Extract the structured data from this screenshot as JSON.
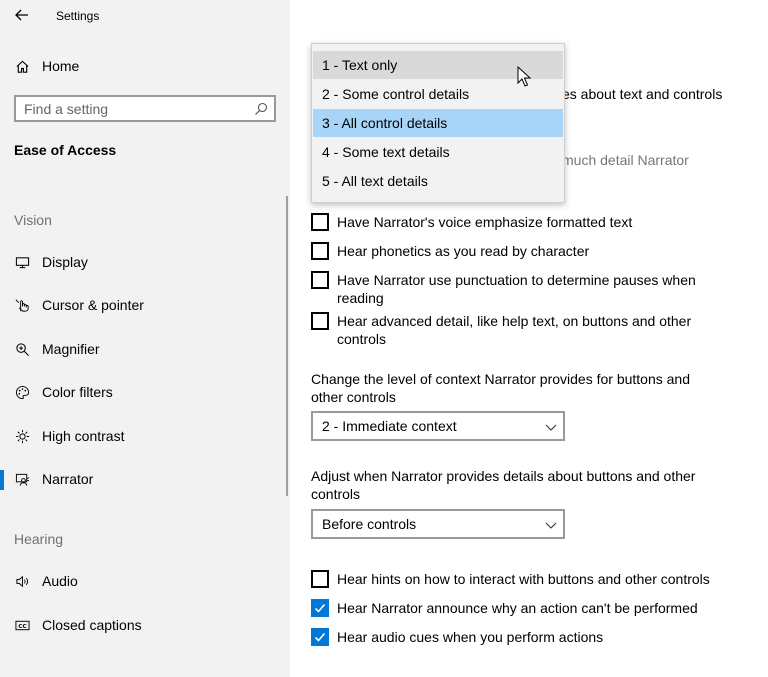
{
  "app": {
    "title": "Settings"
  },
  "sidebar": {
    "home": "Home",
    "search_placeholder": "Find a setting",
    "group_title": "Ease of Access",
    "sections": {
      "vision": "Vision",
      "hearing": "Hearing"
    },
    "items": [
      {
        "label": "Display",
        "icon": "display-icon"
      },
      {
        "label": "Cursor & pointer",
        "icon": "pointer-icon"
      },
      {
        "label": "Magnifier",
        "icon": "magnifier-icon"
      },
      {
        "label": "Color filters",
        "icon": "palette-icon"
      },
      {
        "label": "High contrast",
        "icon": "sun-icon"
      },
      {
        "label": "Narrator",
        "icon": "narrator-icon",
        "selected": true
      },
      {
        "label": "Audio",
        "icon": "speaker-icon"
      },
      {
        "label": "Closed captions",
        "icon": "captions-icon"
      }
    ]
  },
  "main": {
    "partial_text_1": "es about text and controls",
    "partial_text_2": "much detail Narrator",
    "dropdown_options": [
      {
        "label": "1 - Text only",
        "state": "hover"
      },
      {
        "label": "2 - Some control details",
        "state": "normal"
      },
      {
        "label": "3 - All control details",
        "state": "selected"
      },
      {
        "label": "4 - Some text details",
        "state": "normal"
      },
      {
        "label": "5 - All text details",
        "state": "normal"
      }
    ],
    "checkboxes_top": [
      {
        "label": "Have Narrator's voice emphasize formatted text",
        "checked": false
      },
      {
        "label": "Hear phonetics as you read by character",
        "checked": false
      },
      {
        "label": "Have Narrator use punctuation to determine pauses when reading",
        "checked": false
      },
      {
        "label": "Hear advanced detail, like help text, on buttons and other controls",
        "checked": false
      }
    ],
    "context_level": {
      "label": "Change the level of context Narrator provides for buttons and other controls",
      "value": "2 - Immediate context"
    },
    "details_timing": {
      "label": "Adjust when Narrator provides details about buttons and other controls",
      "value": "Before controls"
    },
    "checkboxes_bottom": [
      {
        "label": "Hear hints on how to interact with buttons and other controls",
        "checked": false
      },
      {
        "label": "Hear Narrator announce why an action can't be performed",
        "checked": true
      },
      {
        "label": "Hear audio cues when you perform actions",
        "checked": true
      }
    ]
  },
  "colors": {
    "accent": "#0078d7",
    "selected_option": "#a8d5f7",
    "sidebar_bg": "#f2f2f2"
  }
}
